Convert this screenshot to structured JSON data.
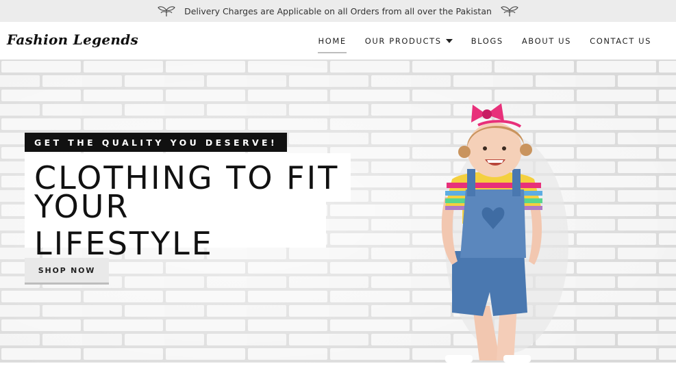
{
  "topbar": {
    "message": "Delivery Charges are Applicable on all Orders from all over the Pakistan",
    "left_icon": "leaf-icon",
    "right_icon": "leaf-icon"
  },
  "header": {
    "logo": "Fashion Legends",
    "nav": [
      {
        "label": "HOME",
        "active": true
      },
      {
        "label": "OUR PRODUCTS",
        "has_dropdown": true
      },
      {
        "label": "BLOGS"
      },
      {
        "label": "ABOUT US"
      },
      {
        "label": "CONTACT US"
      }
    ]
  },
  "hero": {
    "eyebrow": "GET THE QUALITY YOU DESERVE!",
    "headline_line1": "CLOTHING TO FIT",
    "headline_line2": "YOUR LIFESTYLE",
    "cta_label": "SHOP NOW"
  },
  "colors": {
    "topbar_bg": "#ececec",
    "eyebrow_bg": "#111111",
    "button_bg": "#e9e9e9",
    "accent_pink": "#e8307a",
    "denim": "#4a78b0"
  }
}
